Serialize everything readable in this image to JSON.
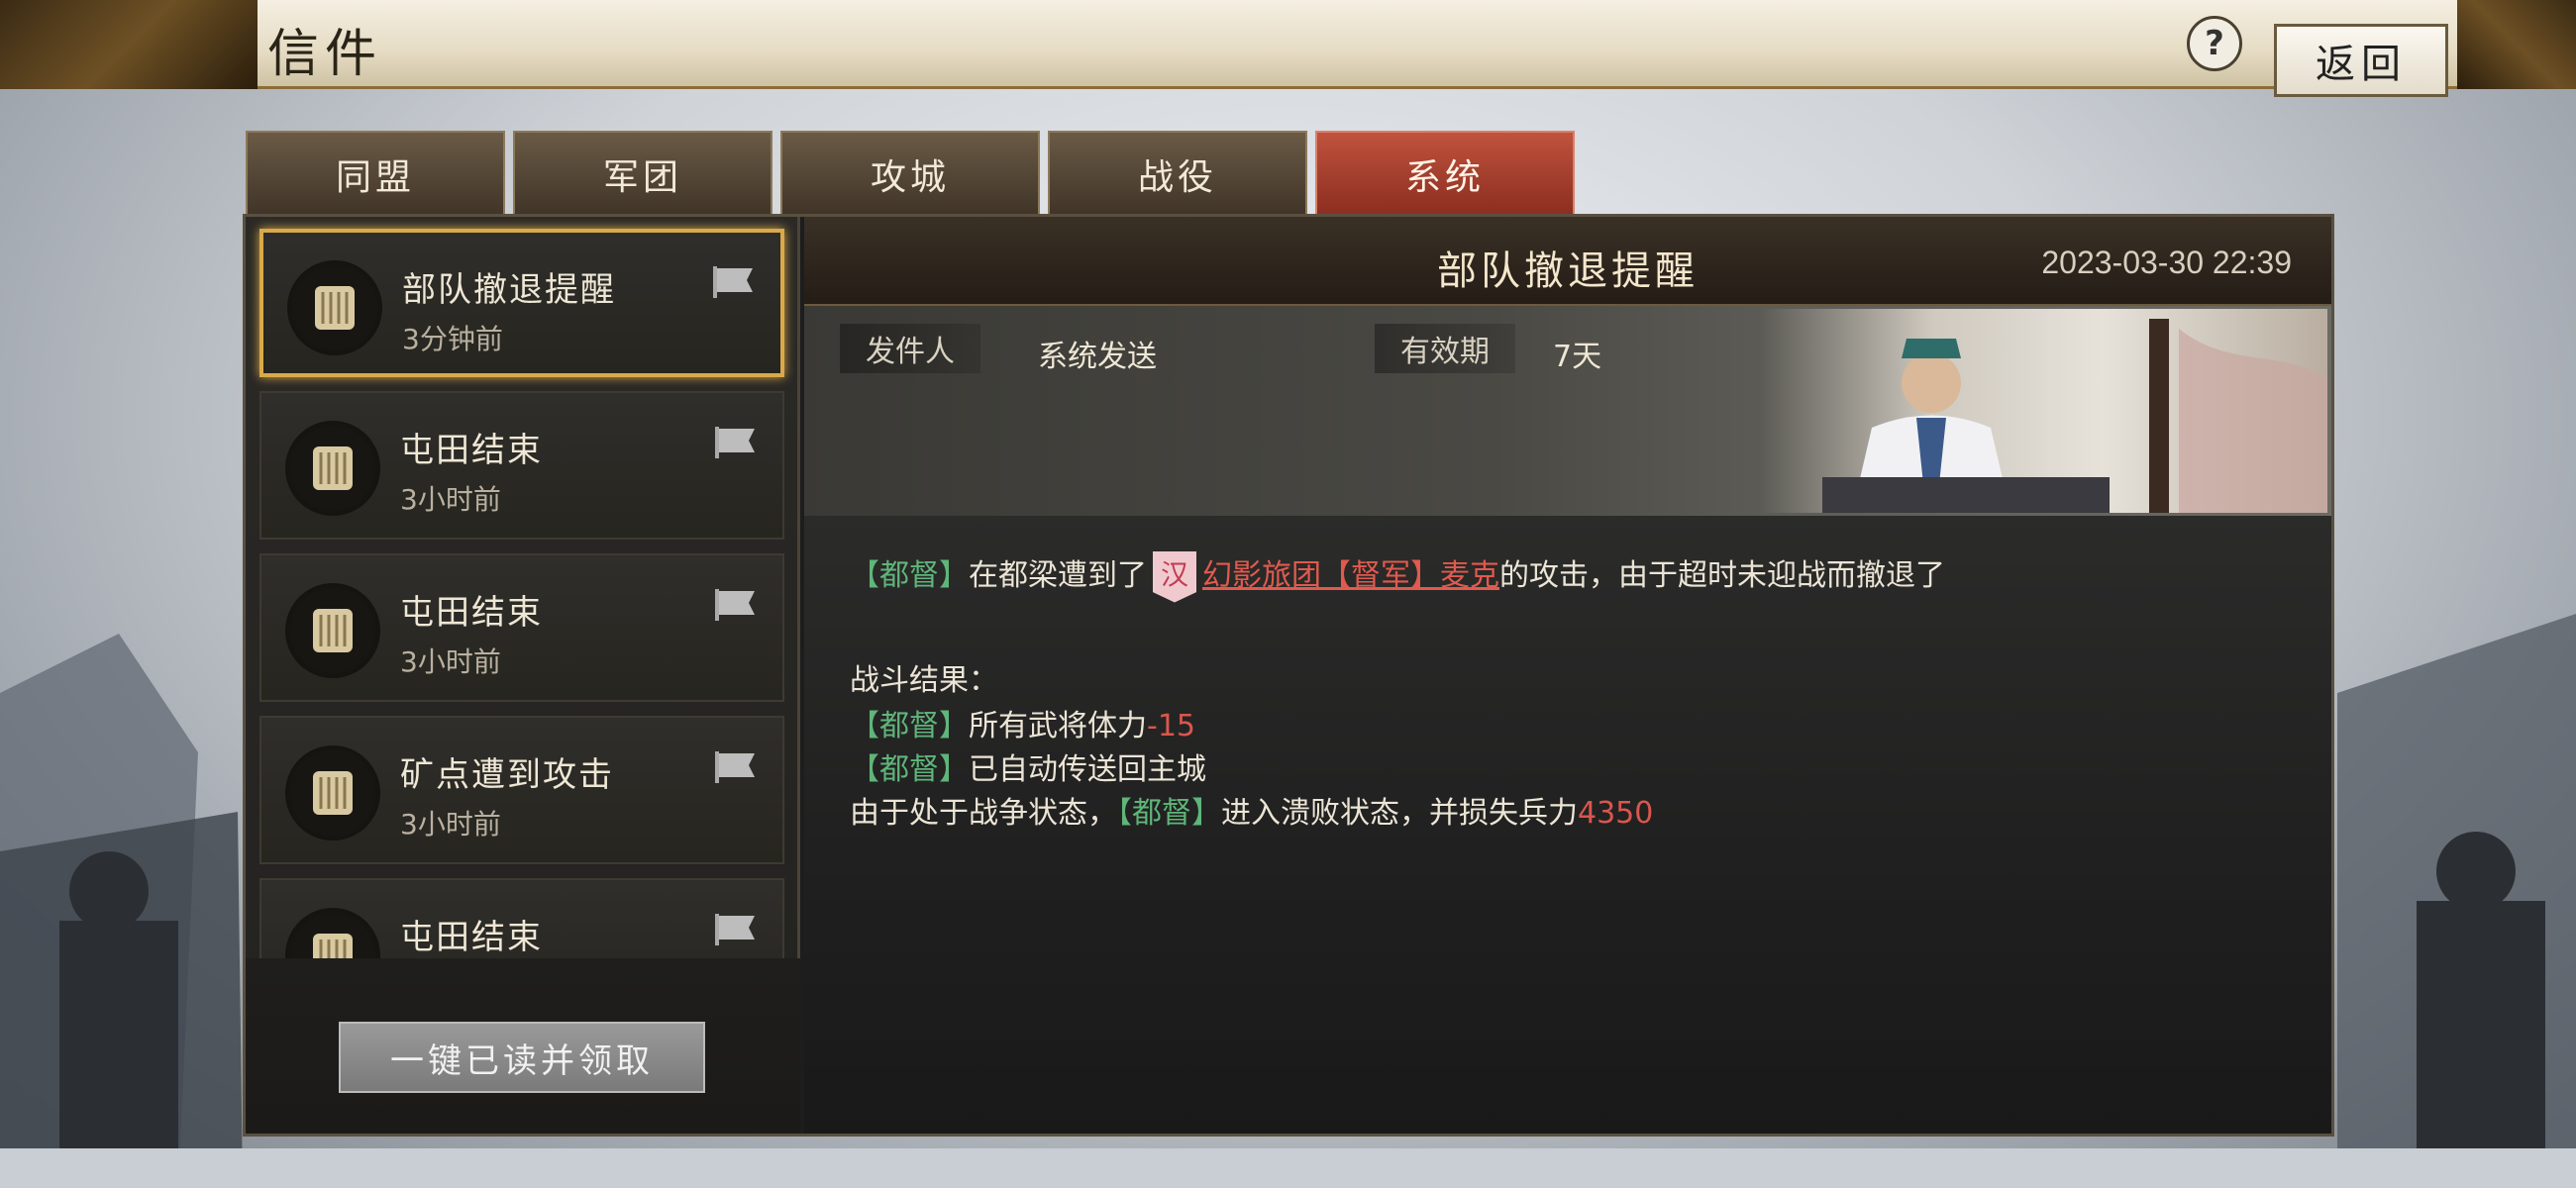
{
  "header": {
    "title": "信件",
    "help_label": "?",
    "back_label": "返回"
  },
  "tabs": [
    {
      "label": "同盟",
      "active": false
    },
    {
      "label": "军团",
      "active": false
    },
    {
      "label": "攻城",
      "active": false
    },
    {
      "label": "战役",
      "active": false
    },
    {
      "label": "系统",
      "active": true
    }
  ],
  "mail_list": [
    {
      "title": "部队撤退提醒",
      "time": "3分钟前",
      "selected": true
    },
    {
      "title": "屯田结束",
      "time": "3小时前",
      "selected": false
    },
    {
      "title": "屯田结束",
      "time": "3小时前",
      "selected": false
    },
    {
      "title": "矿点遭到攻击",
      "time": "3小时前",
      "selected": false
    },
    {
      "title": "屯田结束",
      "time": "",
      "selected": false
    }
  ],
  "claim_all_label": "一键已读并领取",
  "mail": {
    "title": "部队撤退提醒",
    "date": "2023-03-30  22:39",
    "sender_label": "发件人",
    "sender_value": "系统发送",
    "validity_label": "有效期",
    "validity_value": "7天",
    "body": {
      "l1_tag": "【都督】",
      "l1_a": "在都梁遭到了",
      "l1_badge": "汉",
      "l1_enemy": "幻影旅团【督军】麦克",
      "l1_b": "的攻击，由于超时未迎战而撤退了",
      "l2": "战斗结果：",
      "l3_tag": "【都督】",
      "l3_a": "所有武将体力",
      "l3_value": "-15",
      "l4_tag": "【都督】",
      "l4_a": "已自动传送回主城",
      "l5_a": "由于处于战争状态，",
      "l5_tag": "【都督】",
      "l5_b": "进入溃败状态，并损失兵力",
      "l5_value": "4350"
    }
  },
  "colors": {
    "tag_green": "#5fb57a",
    "negative_red": "#d9574d",
    "active_tab": "#b14a36",
    "selected_border": "#d9a94a"
  }
}
